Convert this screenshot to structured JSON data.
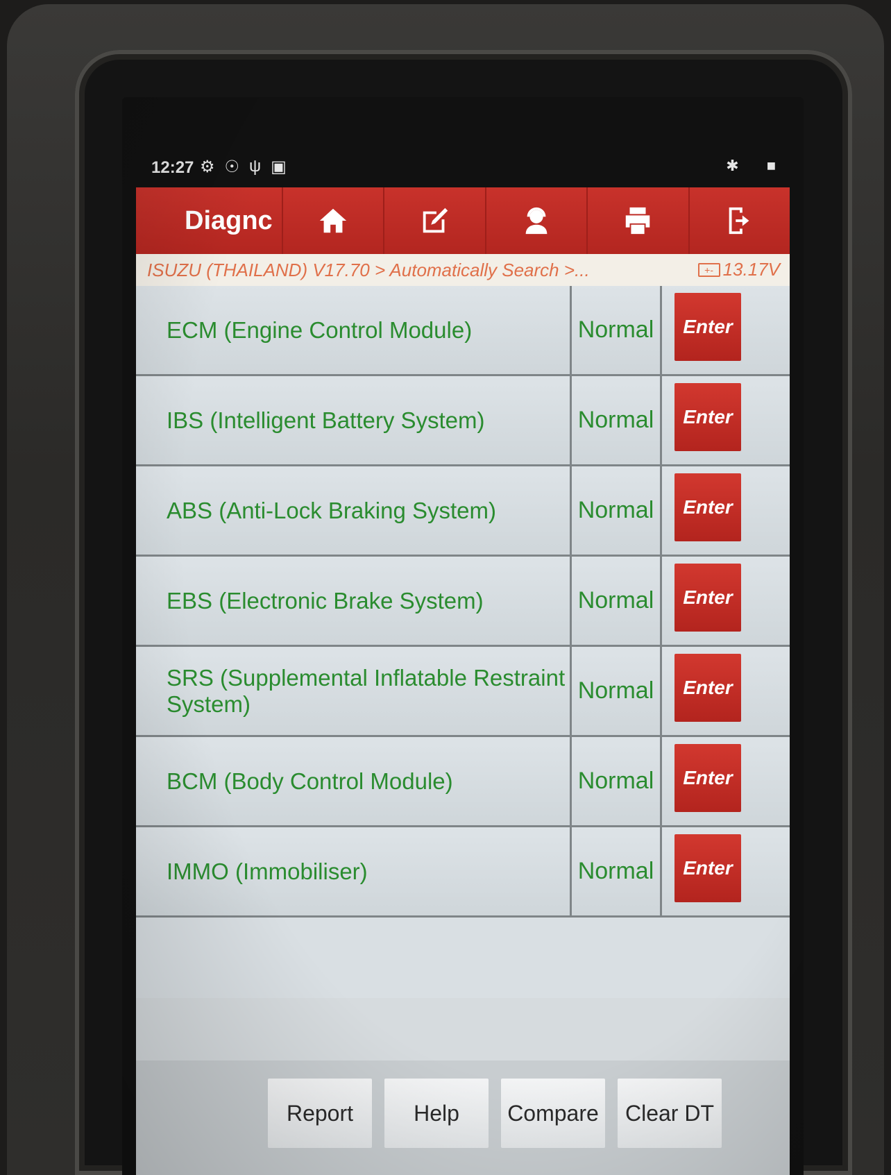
{
  "status_bar": {
    "time": "12:27",
    "left_icons": [
      "gear-icon",
      "chrome-icon",
      "usb-icon",
      "image-icon"
    ],
    "right_icons": [
      "bluetooth-icon",
      "battery-icon"
    ]
  },
  "header": {
    "title": "Diagnc",
    "toolbar": [
      "home-icon",
      "edit-icon",
      "support-icon",
      "print-icon",
      "exit-icon"
    ]
  },
  "breadcrumb": {
    "path": "ISUZU (THAILAND) V17.70 > Automatically Search >...",
    "voltage": "13.17V"
  },
  "systems": [
    {
      "name": "ECM (Engine Control Module)",
      "status": "Normal",
      "action": "Enter"
    },
    {
      "name": "IBS (Intelligent Battery System)",
      "status": "Normal",
      "action": "Enter"
    },
    {
      "name": "ABS (Anti-Lock Braking System)",
      "status": "Normal",
      "action": "Enter"
    },
    {
      "name": "EBS (Electronic Brake System)",
      "status": "Normal",
      "action": "Enter"
    },
    {
      "name": "SRS (Supplemental Inflatable Restraint System)",
      "status": "Normal",
      "action": "Enter"
    },
    {
      "name": "BCM (Body Control Module)",
      "status": "Normal",
      "action": "Enter"
    },
    {
      "name": "IMMO (Immobiliser)",
      "status": "Normal",
      "action": "Enter"
    }
  ],
  "bottom_buttons": {
    "report": "Report",
    "help": "Help",
    "compare": "Compare",
    "clear_dtc": "Clear DT"
  },
  "colors": {
    "header_red": "#c8322b",
    "status_green": "#2a8c2f",
    "breadcrumb_orange": "#e0704a"
  }
}
